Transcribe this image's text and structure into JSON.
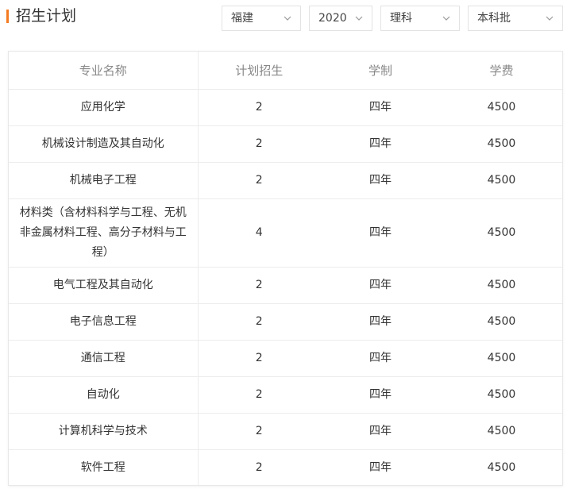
{
  "header": {
    "title": "招生计划"
  },
  "filters": {
    "province": "福建",
    "year": "2020",
    "subject": "理科",
    "batch": "本科批"
  },
  "table": {
    "columns": [
      "专业名称",
      "计划招生",
      "学制",
      "学费"
    ],
    "rows": [
      [
        "应用化学",
        "2",
        "四年",
        "4500"
      ],
      [
        "机械设计制造及其自动化",
        "2",
        "四年",
        "4500"
      ],
      [
        "机械电子工程",
        "2",
        "四年",
        "4500"
      ],
      [
        "材料类（含材料科学与工程、无机非金属材料工程、高分子材料与工程）",
        "4",
        "四年",
        "4500"
      ],
      [
        "电气工程及其自动化",
        "2",
        "四年",
        "4500"
      ],
      [
        "电子信息工程",
        "2",
        "四年",
        "4500"
      ],
      [
        "通信工程",
        "2",
        "四年",
        "4500"
      ],
      [
        "自动化",
        "2",
        "四年",
        "4500"
      ],
      [
        "计算机科学与技术",
        "2",
        "四年",
        "4500"
      ],
      [
        "软件工程",
        "2",
        "四年",
        "4500"
      ]
    ]
  },
  "icons": {
    "dropdown": "chevron-down-icon"
  },
  "colors": {
    "accent": "#f47b20",
    "border": "#e3e3e3",
    "header_text": "#888888"
  }
}
